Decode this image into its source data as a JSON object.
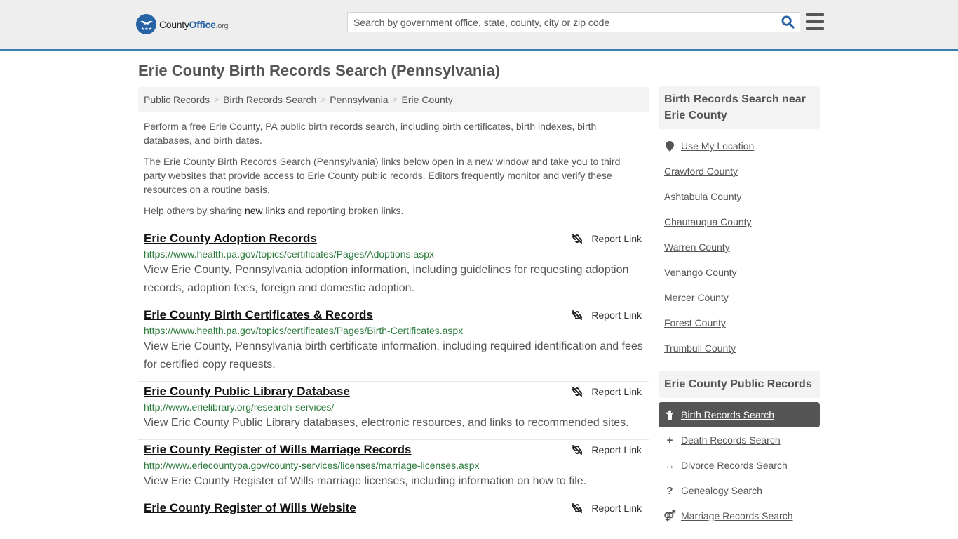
{
  "header": {
    "logo": {
      "name": "County",
      "brand": "Office",
      "tld": ".org"
    },
    "search_placeholder": "Search by government office, state, county, city or zip code",
    "search_value": ""
  },
  "page_title": "Erie County Birth Records Search (Pennsylvania)",
  "breadcrumb": [
    "Public Records",
    "Birth Records Search",
    "Pennsylvania",
    "Erie County"
  ],
  "intro": {
    "p1": "Perform a free Erie County, PA public birth records search, including birth certificates, birth indexes, birth databases, and birth dates.",
    "p2": "The Erie County Birth Records Search (Pennsylvania) links below open in a new window and take you to third party websites that provide access to Erie County public records. Editors frequently monitor and verify these resources on a routine basis.",
    "p3_before": "Help others by sharing ",
    "p3_link": "new links",
    "p3_after": " and reporting broken links."
  },
  "report_label": "Report Link",
  "results": [
    {
      "title": "Erie County Adoption Records",
      "url": "https://www.health.pa.gov/topics/certificates/Pages/Adoptions.aspx",
      "description": "View Erie County, Pennsylvania adoption information, including guidelines for requesting adoption records, adoption fees, foreign and domestic adoption."
    },
    {
      "title": "Erie County Birth Certificates & Records",
      "url": "https://www.health.pa.gov/topics/certificates/Pages/Birth-Certificates.aspx",
      "description": "View Erie County, Pennsylvania birth certificate information, including required identification and fees for certified copy requests."
    },
    {
      "title": "Erie County Public Library Database",
      "url": "http://www.erielibrary.org/research-services/",
      "description": "View Eric County Public Library databases, electronic resources, and links to recommended sites."
    },
    {
      "title": "Erie County Register of Wills Marriage Records",
      "url": "http://www.eriecountypa.gov/county-services/licenses/marriage-licenses.aspx",
      "description": "View Erie County Register of Wills marriage licenses, including information on how to file."
    },
    {
      "title": "Erie County Register of Wills Website",
      "url": "",
      "description": ""
    }
  ],
  "sidebar": {
    "nearby_heading": "Birth Records Search near Erie County",
    "use_location": "Use My Location",
    "nearby": [
      "Crawford County",
      "Ashtabula County",
      "Chautauqua County",
      "Warren County",
      "Venango County",
      "Mercer County",
      "Forest County",
      "Trumbull County"
    ],
    "public_records_heading": "Erie County Public Records",
    "public_records": [
      {
        "label": "Birth Records Search",
        "icon": "child-icon",
        "active": true
      },
      {
        "label": "Death Records Search",
        "icon": "cross-icon",
        "active": false
      },
      {
        "label": "Divorce Records Search",
        "icon": "arrows-horizontal-icon",
        "active": false
      },
      {
        "label": "Genealogy Search",
        "icon": "question-icon",
        "active": false
      },
      {
        "label": "Marriage Records Search",
        "icon": "venus-mars-icon",
        "active": false
      }
    ]
  }
}
